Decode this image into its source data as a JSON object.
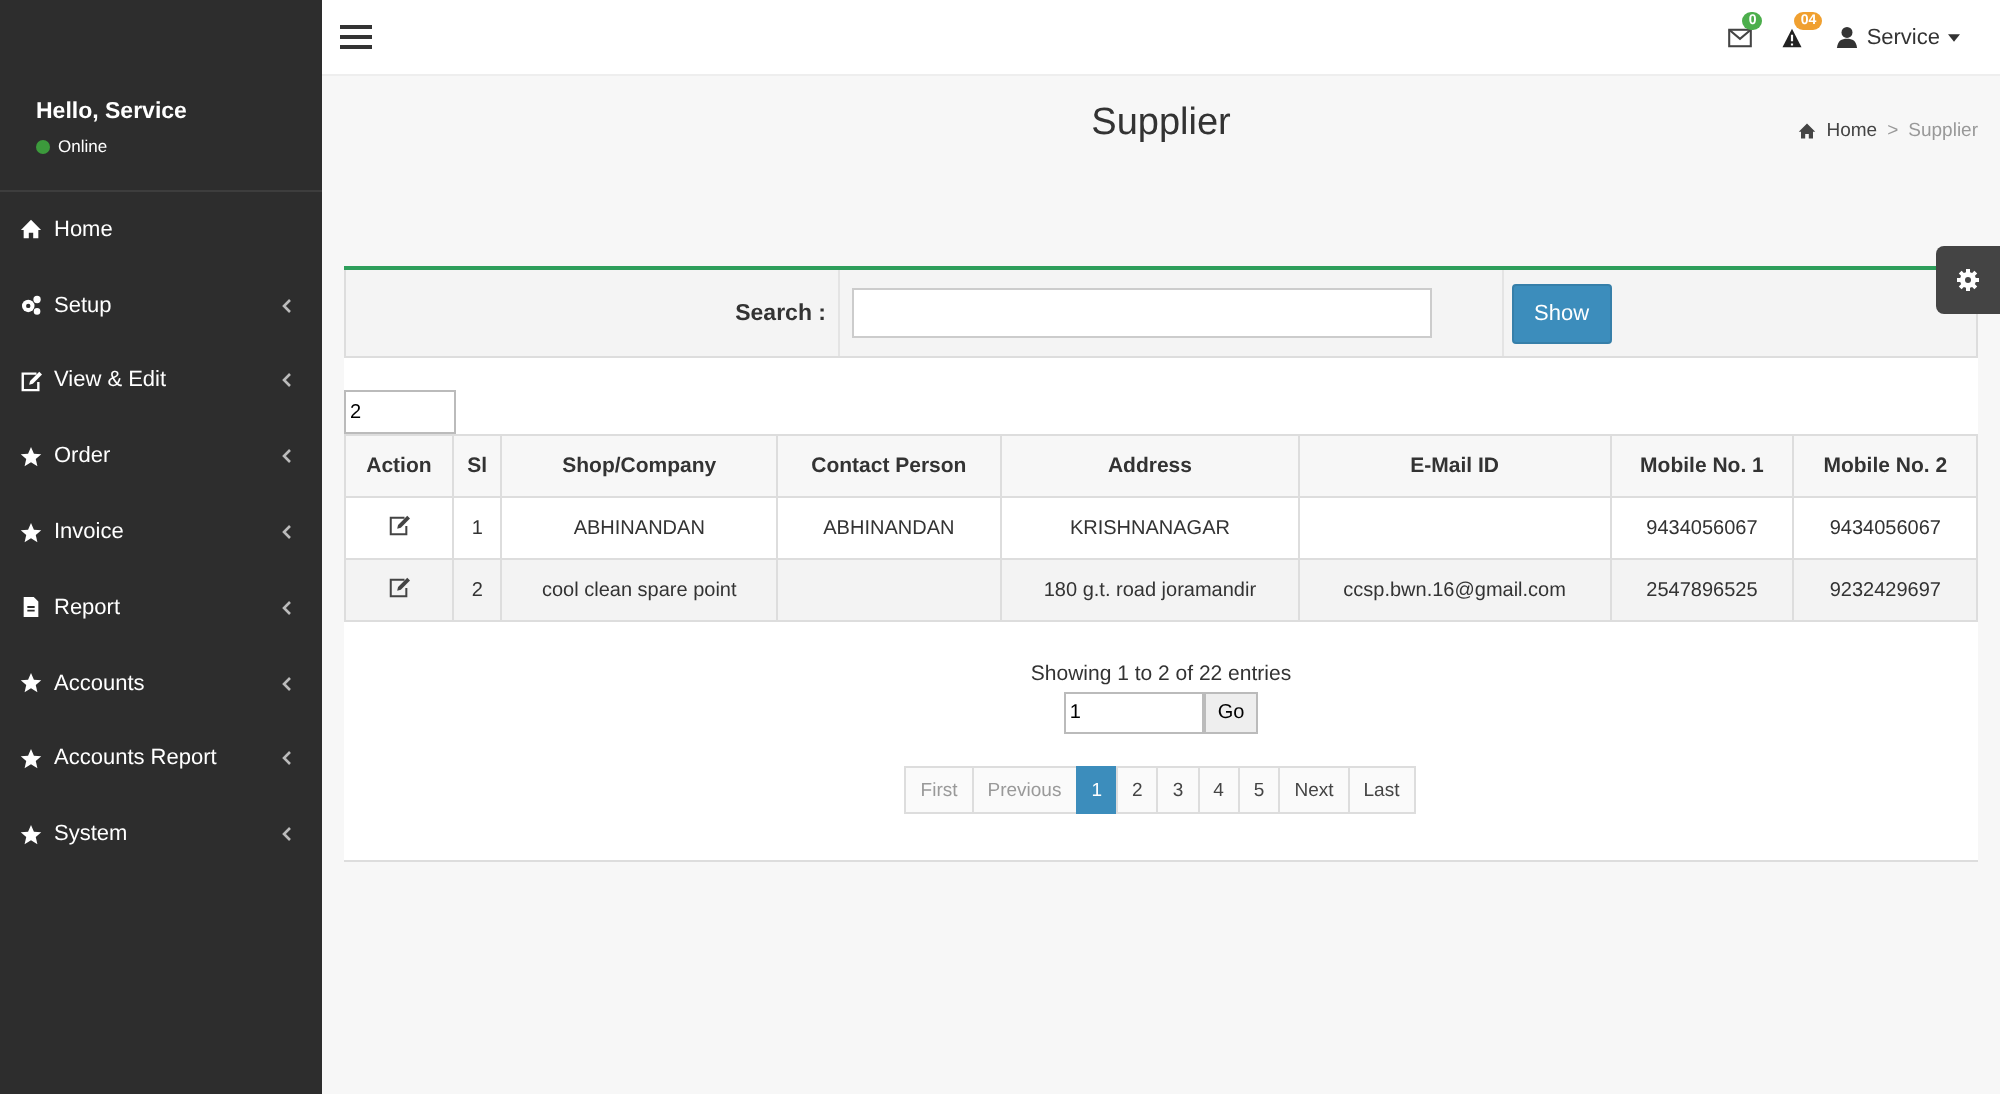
{
  "topbar": {
    "mail_badge": "0",
    "alert_badge": "04",
    "user": "Service"
  },
  "sidebar": {
    "greeting": "Hello, Service",
    "status": "Online",
    "items": [
      {
        "label": "Home",
        "kind": "home",
        "expandable": false
      },
      {
        "label": "Setup",
        "kind": "gears",
        "expandable": true
      },
      {
        "label": "View & Edit",
        "kind": "edit",
        "expandable": true
      },
      {
        "label": "Order",
        "kind": "star",
        "expandable": true
      },
      {
        "label": "Invoice",
        "kind": "star",
        "expandable": true
      },
      {
        "label": "Report",
        "kind": "file",
        "expandable": true
      },
      {
        "label": "Accounts",
        "kind": "star",
        "expandable": true
      },
      {
        "label": "Accounts Report",
        "kind": "star",
        "expandable": true
      },
      {
        "label": "System",
        "kind": "star",
        "expandable": true
      }
    ]
  },
  "page": {
    "title": "Supplier",
    "breadcrumb": [
      "Home",
      "Supplier"
    ],
    "breadcrumb_separator": ">"
  },
  "search": {
    "label": "Search :",
    "button": "Show"
  },
  "page_size": "2",
  "table": {
    "columns": [
      "Action",
      "Sl",
      "Shop/Company",
      "Contact Person",
      "Address",
      "E-Mail ID",
      "Mobile No. 1",
      "Mobile No. 2"
    ],
    "rows": [
      [
        "",
        "1",
        "ABHINANDAN",
        "ABHINANDAN",
        "KRISHNANAGAR",
        "",
        "9434056067",
        "9434056067"
      ],
      [
        "",
        "2",
        "cool clean spare point",
        "",
        "180 g.t. road joramandir",
        "ccsp.bwn.16@gmail.com",
        "2547896525",
        "9232429697"
      ]
    ]
  },
  "summary": "Showing 1 to 2 of 22 entries",
  "goto": {
    "value": "1",
    "button": "Go"
  },
  "pagination": [
    {
      "label": "First",
      "selected": false,
      "disabled": true
    },
    {
      "label": "Previous",
      "selected": false,
      "disabled": true
    },
    {
      "label": "1",
      "selected": true,
      "disabled": false
    },
    {
      "label": "2",
      "selected": false,
      "disabled": false
    },
    {
      "label": "3",
      "selected": false,
      "disabled": false
    },
    {
      "label": "4",
      "selected": false,
      "disabled": false
    },
    {
      "label": "5",
      "selected": false,
      "disabled": false
    },
    {
      "label": "Next",
      "selected": false,
      "disabled": false
    },
    {
      "label": "Last",
      "selected": false,
      "disabled": false
    }
  ]
}
